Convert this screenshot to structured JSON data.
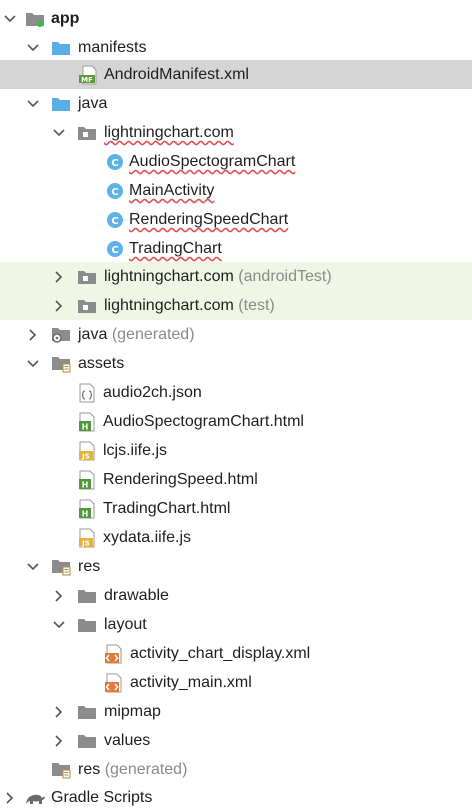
{
  "tree": {
    "app": "app",
    "manifests": "manifests",
    "android_manifest": "AndroidManifest.xml",
    "java": "java",
    "pkg_main": "lightningchart.com",
    "classes": [
      "AudioSpectogramChart",
      "MainActivity",
      "RenderingSpeedChart",
      "TradingChart"
    ],
    "pkg_android_test": "lightningchart.com",
    "pkg_android_test_suffix": "(androidTest)",
    "pkg_test": "lightningchart.com",
    "pkg_test_suffix": "(test)",
    "java_generated": "java",
    "java_generated_suffix": "(generated)",
    "assets": "assets",
    "asset_files": [
      {
        "name": "audio2ch.json",
        "icon": "json-icon"
      },
      {
        "name": "AudioSpectogramChart.html",
        "icon": "html-icon"
      },
      {
        "name": "lcjs.iife.js",
        "icon": "js-icon"
      },
      {
        "name": "RenderingSpeed.html",
        "icon": "html-icon"
      },
      {
        "name": "TradingChart.html",
        "icon": "html-icon"
      },
      {
        "name": "xydata.iife.js",
        "icon": "js-icon"
      }
    ],
    "res": "res",
    "res_children": [
      "drawable",
      "layout"
    ],
    "layout_files": [
      "activity_chart_display.xml",
      "activity_main.xml"
    ],
    "res_more": [
      "mipmap",
      "values"
    ],
    "res_generated": "res",
    "res_generated_suffix": "(generated)",
    "gradle": "Gradle Scripts"
  },
  "icon_glyphs": {
    "class": "C",
    "manifest": "MF",
    "html": "H",
    "js": "JS"
  },
  "colors": {
    "selected_bg": "#d5d5d5",
    "test_bg": "#eff6e6",
    "folder_blue": "#5aaee8",
    "folder_gray": "#8c8c8c",
    "class_circle": "#5fb2e6",
    "error_underline": "#e05050"
  }
}
